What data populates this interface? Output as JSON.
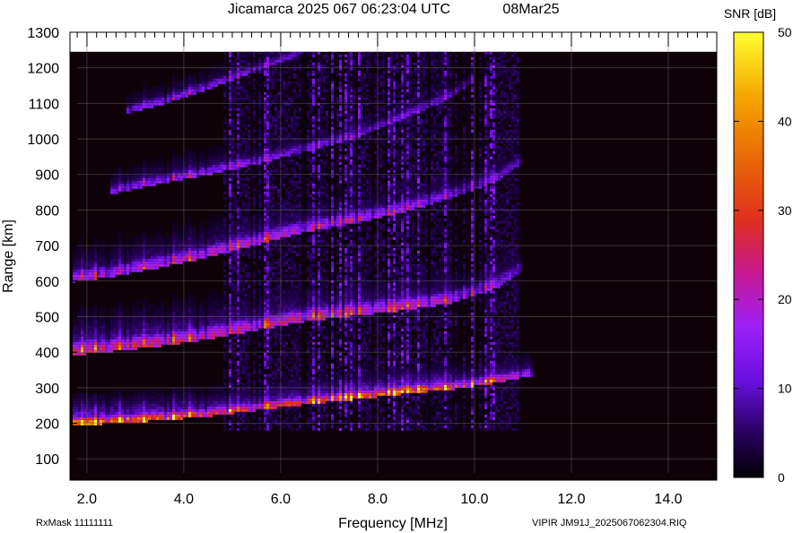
{
  "chart_data": {
    "type": "heatmap",
    "title": "Jicamarca 2025 067 06:23:04 UTC",
    "date": "08Mar25",
    "xlabel": "Frequency [MHz]",
    "ylabel": "Range [km]",
    "xlim": [
      1.65,
      15.0
    ],
    "ylim": [
      40,
      1300
    ],
    "data_top": 1245,
    "xticks": [
      2.0,
      4.0,
      6.0,
      8.0,
      10.0,
      12.0,
      14.0
    ],
    "xtick_labels": [
      "2.0",
      "4.0",
      "6.0",
      "8.0",
      "10.0",
      "12.0",
      "14.0"
    ],
    "yticks": [
      100,
      200,
      300,
      400,
      500,
      600,
      700,
      800,
      900,
      1000,
      1100,
      1200,
      1300
    ],
    "ytick_labels": [
      "100",
      "200",
      "300",
      "400",
      "500",
      "600",
      "700",
      "800",
      "900",
      "1000",
      "1100",
      "1200",
      "1300"
    ],
    "colorbar": {
      "label": "SNR [dB]",
      "range": [
        0,
        50
      ],
      "ticks": [
        0,
        10,
        20,
        30,
        40,
        50
      ],
      "tick_labels": [
        "0",
        "10",
        "20",
        "30",
        "40",
        "50"
      ]
    },
    "traces": [
      {
        "name": "",
        "x": [
          1.7,
          2.5,
          3.5,
          4.5,
          5.5,
          6.5,
          7.5,
          8.5,
          9.5,
          10.5,
          11.2
        ],
        "y": [
          198,
          205,
          213,
          225,
          242,
          258,
          272,
          287,
          300,
          320,
          340
        ],
        "snr": [
          42,
          40,
          36,
          30,
          28,
          32,
          35,
          36,
          34,
          26,
          18
        ],
        "width": 14
      },
      {
        "name": "",
        "x": [
          1.7,
          2.5,
          3.5,
          4.5,
          5.5,
          6.5,
          7.5,
          8.5,
          9.5,
          10.5,
          11.0
        ],
        "y": [
          400,
          410,
          425,
          445,
          470,
          495,
          510,
          525,
          545,
          590,
          640
        ],
        "snr": [
          25,
          28,
          26,
          24,
          22,
          24,
          22,
          22,
          20,
          14,
          10
        ],
        "width": 22
      },
      {
        "name": "",
        "x": [
          1.7,
          2.5,
          3.5,
          4.5,
          5.5,
          6.5,
          7.5,
          8.5,
          9.5,
          10.5,
          11.0
        ],
        "y": [
          605,
          620,
          645,
          675,
          710,
          745,
          770,
          800,
          840,
          890,
          940
        ],
        "snr": [
          18,
          19,
          20,
          21,
          22,
          20,
          18,
          16,
          14,
          12,
          9
        ],
        "width": 20
      },
      {
        "name": "",
        "x": [
          2.5,
          3.5,
          4.5,
          5.5,
          6.5,
          7.5,
          8.5,
          9.5,
          10.0
        ],
        "y": [
          850,
          880,
          905,
          935,
          970,
          1005,
          1060,
          1120,
          1170
        ],
        "snr": [
          14,
          15,
          16,
          14,
          12,
          12,
          11,
          10,
          9
        ],
        "width": 16
      },
      {
        "name": "",
        "x": [
          2.8,
          3.5,
          4.5,
          5.5,
          6.5
        ],
        "y": [
          1075,
          1100,
          1145,
          1195,
          1245
        ],
        "snr": [
          13,
          14,
          14,
          12,
          10
        ],
        "width": 14
      }
    ]
  },
  "footer": {
    "left": "RxMask 11111111",
    "right": "VIPIR  JM91J_2025067062304.RIQ"
  }
}
